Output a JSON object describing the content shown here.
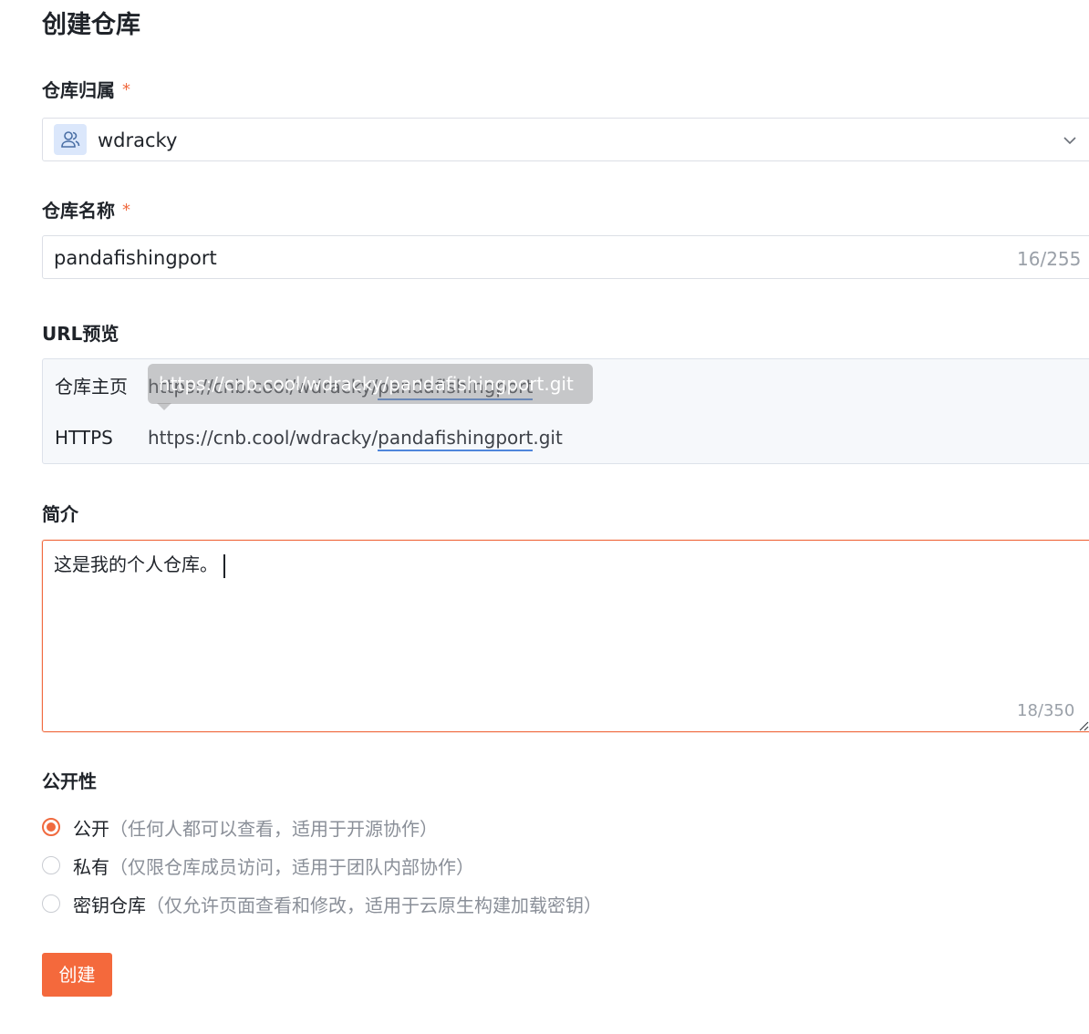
{
  "page": {
    "title": "创建仓库"
  },
  "owner": {
    "label": "仓库归属",
    "required_mark": "*",
    "value": "wdracky",
    "avatar_icon": "users-icon",
    "dropdown_icon": "chevron-down-icon"
  },
  "repo_name": {
    "label": "仓库名称",
    "required_mark": "*",
    "value": "pandafishingport",
    "counter": "16/255"
  },
  "url_preview": {
    "label": "URL预览",
    "rows": [
      {
        "label": "仓库主页",
        "prefix": "https://cnb.cool/wdracky/",
        "name": "pandafishingport",
        "suffix": ""
      },
      {
        "label": "HTTPS",
        "prefix": "https://cnb.cool/wdracky/",
        "name": "pandafishingport",
        "suffix": ".git"
      }
    ],
    "tooltip": "https://cnb.cool/wdracky/pandafishingport.git"
  },
  "description": {
    "label": "简介",
    "value": "这是我的个人仓库。",
    "counter": "18/350"
  },
  "visibility": {
    "label": "公开性",
    "selected": "public",
    "options": [
      {
        "key": "public",
        "label": "公开",
        "hint": "（任何人都可以查看，适用于开源协作）"
      },
      {
        "key": "private",
        "label": "私有",
        "hint": "（仅限仓库成员访问，适用于团队内部协作）"
      },
      {
        "key": "secret",
        "label": "密钥仓库",
        "hint": "（仅允许页面查看和修改，适用于云原生构建加载密钥）"
      }
    ]
  },
  "actions": {
    "create_label": "创建"
  },
  "colors": {
    "accent": "#f4693c",
    "link_underline": "#4f86db",
    "avatar_bg": "#dbe7fb"
  }
}
